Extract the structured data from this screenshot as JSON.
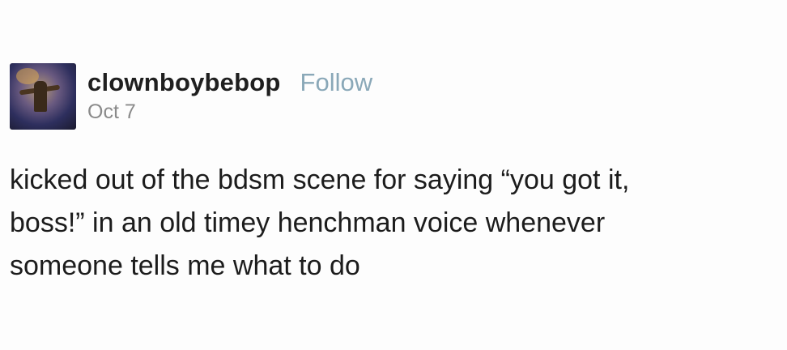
{
  "post": {
    "author": {
      "username": "clownboybebop",
      "follow_label": "Follow",
      "avatar_icon": "user-avatar"
    },
    "date": "Oct 7",
    "body_lines": [
      "kicked out of the bdsm scene for saying “you got it,",
      "boss!” in an old timey henchman voice whenever",
      "someone tells me what to do"
    ]
  },
  "colors": {
    "follow": "#8aa8b8",
    "date": "#8a8a8a",
    "text": "#1c1c1c"
  }
}
